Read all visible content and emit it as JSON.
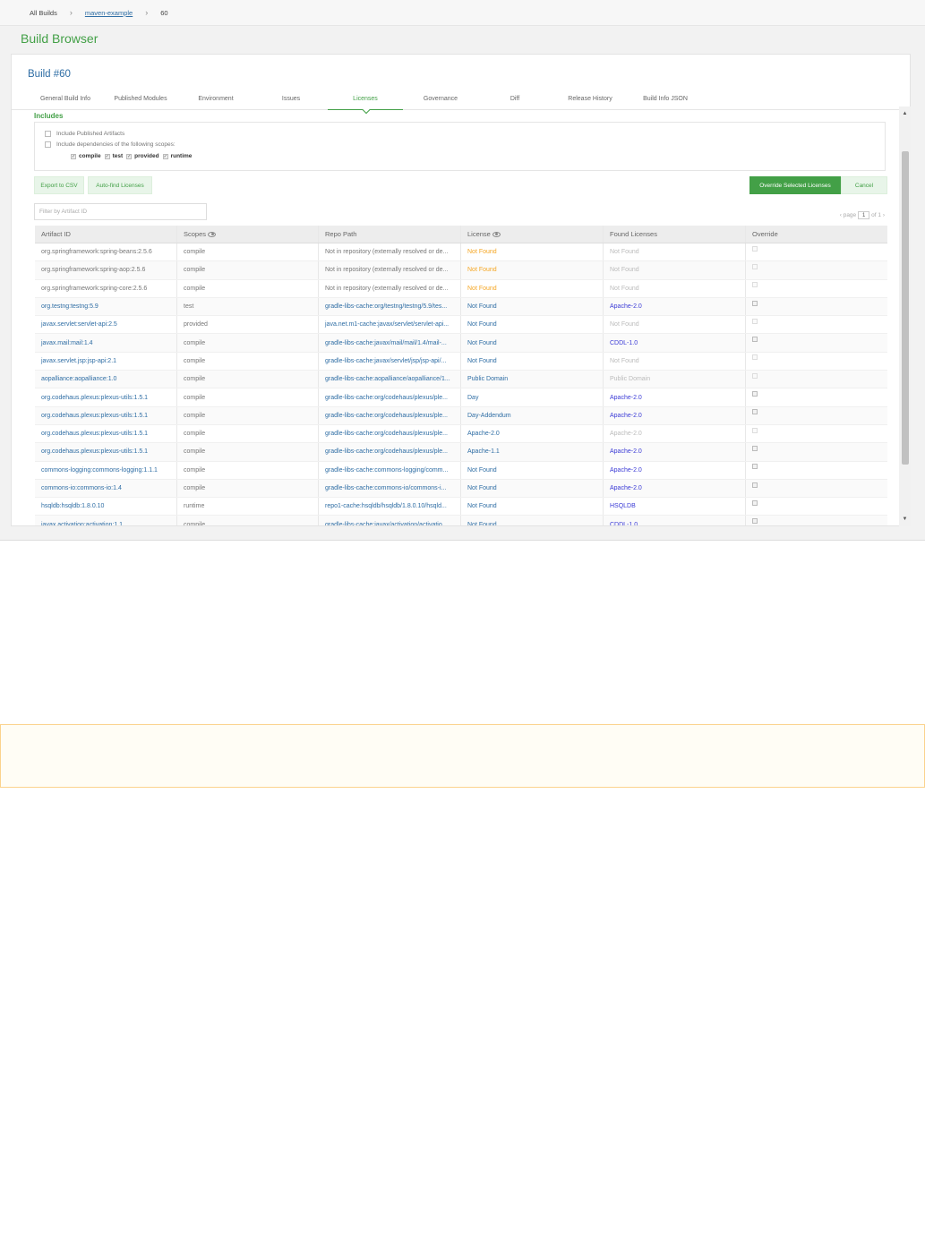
{
  "breadcrumb": {
    "items": [
      "All Builds",
      "maven-example",
      "60"
    ],
    "separator": "›"
  },
  "page_title": "Build Browser",
  "build_title": "Build #60",
  "tabs": [
    {
      "label": "General Build Info",
      "active": false
    },
    {
      "label": "Published Modules",
      "active": false
    },
    {
      "label": "Environment",
      "active": false
    },
    {
      "label": "Issues",
      "active": false
    },
    {
      "label": "Licenses",
      "active": true
    },
    {
      "label": "Governance",
      "active": false
    },
    {
      "label": "Diff",
      "active": false
    },
    {
      "label": "Release History",
      "active": false
    },
    {
      "label": "Build Info JSON",
      "active": false
    }
  ],
  "includes": {
    "title": "Includes",
    "published_artifacts": "Include Published Artifacts",
    "dependencies": "Include dependencies of the following scopes:",
    "scopes": [
      "compile",
      "test",
      "provided",
      "runtime"
    ]
  },
  "buttons": {
    "export": "Export to CSV",
    "autofind": "Auto-find Licenses",
    "override": "Override Selected Licenses",
    "cancel": "Cancel"
  },
  "filter": {
    "placeholder": "Filter by Artifact ID"
  },
  "pager": {
    "prefix": "page",
    "value": "1",
    "suffix": "of 1"
  },
  "grid": {
    "headers": [
      "Artifact ID",
      "Scopes",
      "Repo Path",
      "License",
      "Found Licenses",
      "Override"
    ],
    "rows": [
      {
        "artifact": "org.springframework:spring-beans:2.5.6",
        "scope": "compile",
        "path": "Not in repository (externally resolved or de...",
        "license": "Not Found",
        "found": "Not Found",
        "style": "gray",
        "lic_style": "orange",
        "found_style": "light"
      },
      {
        "artifact": "org.springframework:spring-aop:2.5.6",
        "scope": "compile",
        "path": "Not in repository (externally resolved or de...",
        "license": "Not Found",
        "found": "Not Found",
        "style": "gray",
        "lic_style": "orange",
        "found_style": "light"
      },
      {
        "artifact": "org.springframework:spring-core:2.5.6",
        "scope": "compile",
        "path": "Not in repository (externally resolved or de...",
        "license": "Not Found",
        "found": "Not Found",
        "style": "gray",
        "lic_style": "orange",
        "found_style": "light"
      },
      {
        "artifact": "org.testng:testng:5.9",
        "scope": "test",
        "path": "gradle-libs-cache:org/testng/testng/5.9/tes...",
        "license": "Not Found",
        "found": "Apache-2.0",
        "style": "blue",
        "lic_style": "blue",
        "found_style": "violet"
      },
      {
        "artifact": "javax.servlet:servlet-api:2.5",
        "scope": "provided",
        "path": "java.net.m1-cache:javax/servlet/servlet-api...",
        "license": "Not Found",
        "found": "Not Found",
        "style": "blue",
        "lic_style": "blue",
        "found_style": "light"
      },
      {
        "artifact": "javax.mail:mail:1.4",
        "scope": "compile",
        "path": "gradle-libs-cache:javax/mail/mail/1.4/mail-...",
        "license": "Not Found",
        "found": "CDDL-1.0",
        "style": "blue",
        "lic_style": "blue",
        "found_style": "violet"
      },
      {
        "artifact": "javax.servlet.jsp:jsp-api:2.1",
        "scope": "compile",
        "path": "gradle-libs-cache:javax/servlet/jsp/jsp-api/...",
        "license": "Not Found",
        "found": "Not Found",
        "style": "blue",
        "lic_style": "blue",
        "found_style": "light"
      },
      {
        "artifact": "aopalliance:aopalliance:1.0",
        "scope": "compile",
        "path": "gradle-libs-cache:aopalliance/aopalliance/1...",
        "license": "Public Domain",
        "found": "Public Domain",
        "style": "blue",
        "lic_style": "blue",
        "found_style": "light"
      },
      {
        "artifact": "org.codehaus.plexus:plexus-utils:1.5.1",
        "scope": "compile",
        "path": "gradle-libs-cache:org/codehaus/plexus/ple...",
        "license": "Day",
        "found": "Apache-2.0",
        "style": "blue",
        "lic_style": "blue",
        "found_style": "violet"
      },
      {
        "artifact": "org.codehaus.plexus:plexus-utils:1.5.1",
        "scope": "compile",
        "path": "gradle-libs-cache:org/codehaus/plexus/ple...",
        "license": "Day-Addendum",
        "found": "Apache-2.0",
        "style": "blue",
        "lic_style": "blue",
        "found_style": "violet"
      },
      {
        "artifact": "org.codehaus.plexus:plexus-utils:1.5.1",
        "scope": "compile",
        "path": "gradle-libs-cache:org/codehaus/plexus/ple...",
        "license": "Apache-2.0",
        "found": "Apache-2.0",
        "style": "blue",
        "lic_style": "blue",
        "found_style": "light"
      },
      {
        "artifact": "org.codehaus.plexus:plexus-utils:1.5.1",
        "scope": "compile",
        "path": "gradle-libs-cache:org/codehaus/plexus/ple...",
        "license": "Apache-1.1",
        "found": "Apache-2.0",
        "style": "blue",
        "lic_style": "blue",
        "found_style": "violet"
      },
      {
        "artifact": "commons-logging:commons-logging:1.1.1",
        "scope": "compile",
        "path": "gradle-libs-cache:commons-logging/comm...",
        "license": "Not Found",
        "found": "Apache-2.0",
        "style": "blue",
        "lic_style": "blue",
        "found_style": "violet"
      },
      {
        "artifact": "commons-io:commons-io:1.4",
        "scope": "compile",
        "path": "gradle-libs-cache:commons-io/commons-i...",
        "license": "Not Found",
        "found": "Apache-2.0",
        "style": "blue",
        "lic_style": "blue",
        "found_style": "violet"
      },
      {
        "artifact": "hsqldb:hsqldb:1.8.0.10",
        "scope": "runtime",
        "path": "repo1-cache:hsqldb/hsqldb/1.8.0.10/hsqld...",
        "license": "Not Found",
        "found": "HSQLDB",
        "style": "blue",
        "lic_style": "blue",
        "found_style": "violet"
      },
      {
        "artifact": "javax.activation:activation:1.1",
        "scope": "compile",
        "path": "gradle-libs-cache:javax/activation/activatio...",
        "license": "Not Found",
        "found": "CDDL-1.0",
        "style": "blue",
        "lic_style": "blue",
        "found_style": "violet"
      }
    ]
  },
  "colors": {
    "accent": "#43a047",
    "link": "#2e6da4",
    "warning": "#f5a623",
    "notice_border": "#fbd38d"
  }
}
